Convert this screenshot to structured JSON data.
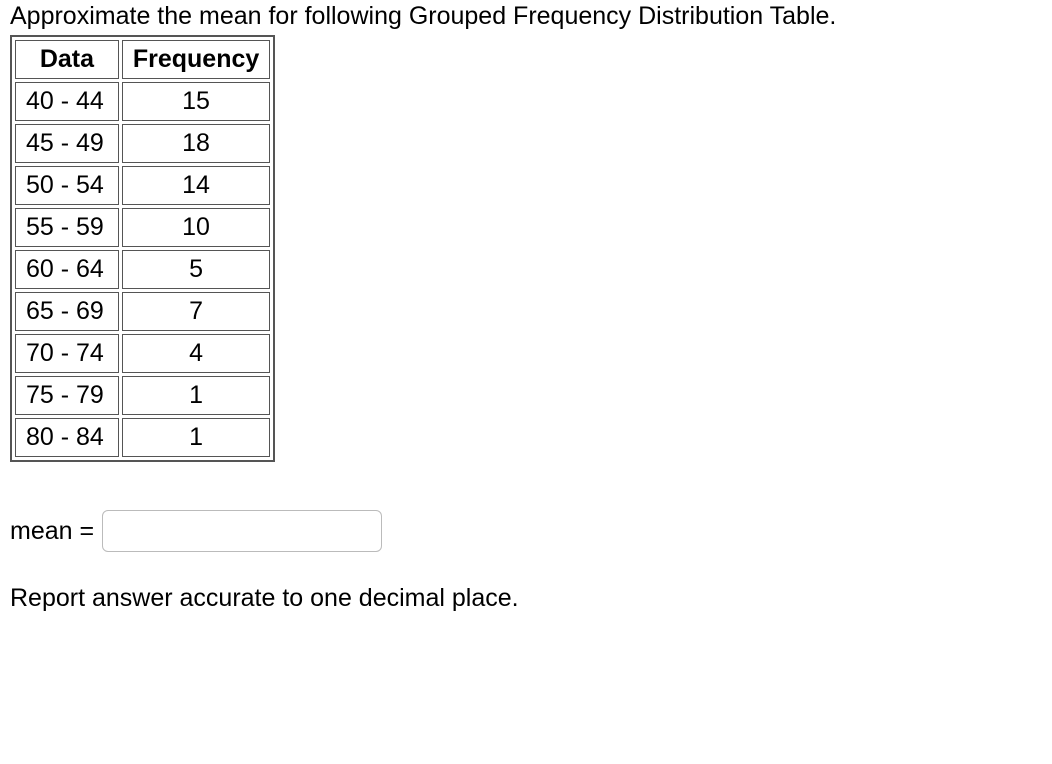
{
  "question_text": "Approximate the mean for following Grouped Frequency Distribution Table.",
  "table": {
    "headers": {
      "data": "Data",
      "frequency": "Frequency"
    },
    "rows": [
      {
        "data": "40 - 44",
        "frequency": "15"
      },
      {
        "data": "45 - 49",
        "frequency": "18"
      },
      {
        "data": "50 - 54",
        "frequency": "14"
      },
      {
        "data": "55 - 59",
        "frequency": "10"
      },
      {
        "data": "60 - 64",
        "frequency": "5"
      },
      {
        "data": "65 - 69",
        "frequency": "7"
      },
      {
        "data": "70 - 74",
        "frequency": "4"
      },
      {
        "data": "75 - 79",
        "frequency": "1"
      },
      {
        "data": "80 - 84",
        "frequency": "1"
      }
    ]
  },
  "answer": {
    "label": "mean = ",
    "value": ""
  },
  "instruction": "Report answer accurate to one decimal place."
}
